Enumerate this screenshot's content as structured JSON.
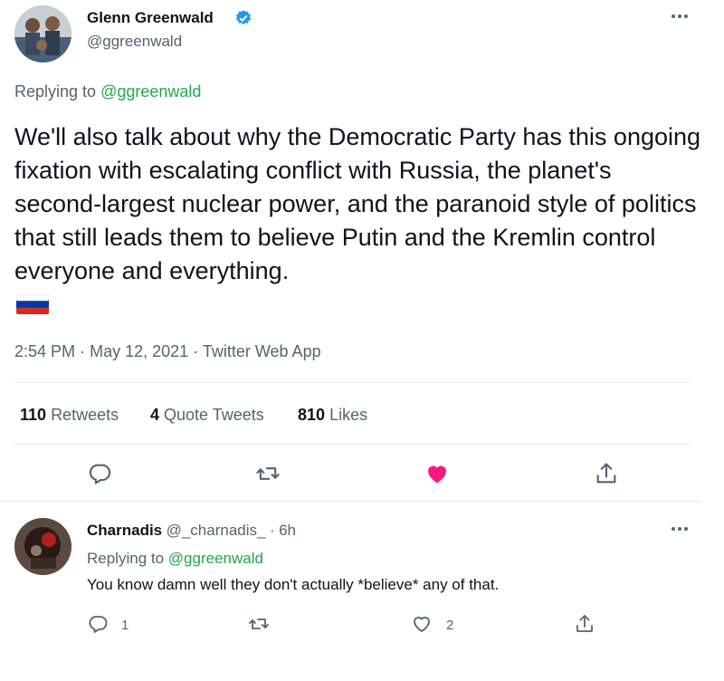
{
  "tweet": {
    "author_name": "Glenn Greenwald",
    "author_handle": "@ggreenwald",
    "replying_prefix": "Replying to",
    "replying_to": "@ggreenwald",
    "text": "We'll also talk about why the Democratic Party has this ongoing fixation with escalating conflict with Russia, the planet's second-largest nuclear power, and the paranoid style of politics that still leads them to believe Putin and the Kremlin control everyone and everything.",
    "time": "2:54 PM",
    "date": "May 12, 2021",
    "source": "Twitter Web App",
    "separator": "·",
    "retweets_count": "110",
    "retweets_label": "Retweets",
    "quotes_count": "4",
    "quotes_label": "Quote Tweets",
    "likes_count": "810",
    "likes_label": "Likes",
    "verified": true
  },
  "reply": {
    "author_name": "Charnadis",
    "author_handle": "@_charnadis_",
    "time_ago": "6h",
    "separator": "·",
    "replying_prefix": "Replying to",
    "replying_to": "@ggreenwald",
    "text": "You know damn well they don't actually *believe* any of that.",
    "reply_count": "1",
    "like_count": "2"
  },
  "icons": {
    "more": "more-icon",
    "reply": "reply-icon",
    "retweet": "retweet-icon",
    "like": "like-icon",
    "share": "share-icon",
    "verified": "verified-badge-icon",
    "flag": "russia-flag-icon"
  },
  "colors": {
    "accent_green": "#22a84a",
    "like_active": "#f91880",
    "verified_blue": "#1d9bf0",
    "muted": "#536471"
  }
}
